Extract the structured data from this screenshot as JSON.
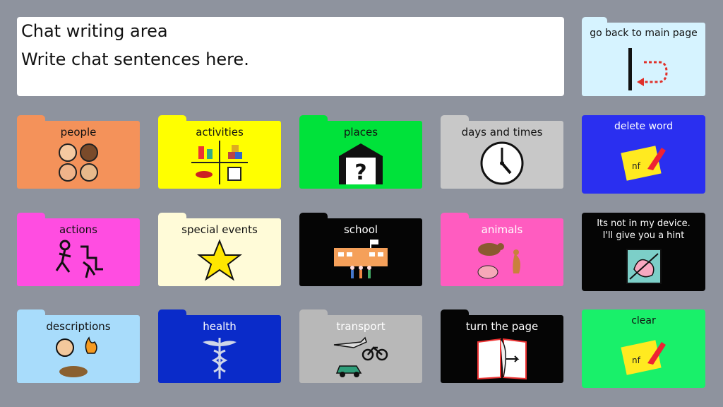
{
  "chat": {
    "title": "Chat writing area",
    "placeholder": "Write chat sentences here."
  },
  "nav": {
    "back_label": "go back to main page"
  },
  "folders": [
    {
      "label": "people",
      "color": "#f4925a",
      "text_color": "#111111",
      "icon": "people-icon"
    },
    {
      "label": "activities",
      "color": "#ffff00",
      "text_color": "#111111",
      "icon": "activities-icon"
    },
    {
      "label": "places",
      "color": "#00e23a",
      "text_color": "#111111",
      "icon": "places-icon"
    },
    {
      "label": "days and times",
      "color": "#c8c8c8",
      "text_color": "#111111",
      "icon": "clock-icon"
    },
    {
      "label": "actions",
      "color": "#ff4de1",
      "text_color": "#111111",
      "icon": "actions-icon"
    },
    {
      "label": "special events",
      "color": "#fffbd8",
      "text_color": "#111111",
      "icon": "star-icon"
    },
    {
      "label": "school",
      "color": "#050505",
      "text_color": "#ffffff",
      "icon": "school-icon"
    },
    {
      "label": "animals",
      "color": "#ff5cc0",
      "text_color": "#ffffff",
      "icon": "animals-icon"
    },
    {
      "label": "descriptions",
      "color": "#a8dcfb",
      "text_color": "#111111",
      "icon": "descriptions-icon"
    },
    {
      "label": "health",
      "color": "#0a2bc9",
      "text_color": "#ffffff",
      "icon": "caduceus-icon"
    },
    {
      "label": "transport",
      "color": "#b8b8b8",
      "text_color": "#ffffff",
      "icon": "transport-icon"
    },
    {
      "label": "turn the page",
      "color": "#050505",
      "text_color": "#ffffff",
      "icon": "book-icon"
    }
  ],
  "side_buttons": {
    "delete_word": {
      "label": "delete word",
      "color": "#2a2ff0",
      "text_color": "#ffffff"
    },
    "hint": {
      "label_line1": "Its not in my device.",
      "label_line2": "I'll give you a hint",
      "color": "#050505",
      "text_color": "#ffffff"
    },
    "clear": {
      "label": "clear",
      "color": "#19f06a",
      "text_color": "#111111"
    }
  },
  "colors": {
    "background": "#8e939e",
    "back_tile": "#d6f3ff"
  }
}
